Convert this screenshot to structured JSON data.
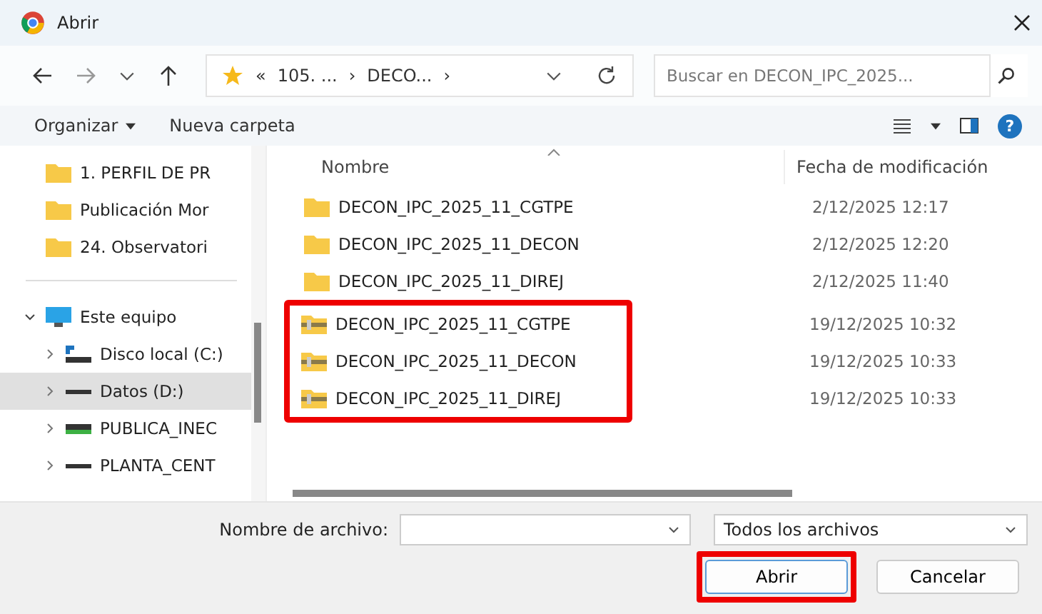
{
  "window": {
    "title": "Abrir"
  },
  "address": {
    "segments": [
      "«",
      "105. ...",
      "›",
      "DECO...",
      "›"
    ]
  },
  "search": {
    "placeholder": "Buscar en DECON_IPC_2025..."
  },
  "toolbar": {
    "organize": "Organizar",
    "new_folder": "Nueva carpeta",
    "help": "?"
  },
  "sidebar": {
    "items": [
      {
        "label": "1. PERFIL DE PR",
        "kind": "folder",
        "selected": false
      },
      {
        "label": "Publicación Mor",
        "kind": "folder",
        "selected": false
      },
      {
        "label": "24. Observatori",
        "kind": "folder",
        "selected": false
      },
      {
        "label": "Este equipo",
        "kind": "pc",
        "selected": false,
        "expanded": true,
        "children": [
          {
            "label": "Disco local (C:)",
            "kind": "system-drive",
            "selected": false,
            "expanded": false
          },
          {
            "label": "Datos (D:)",
            "kind": "drive",
            "selected": true,
            "expanded": false
          },
          {
            "label": "PUBLICA_INEC",
            "kind": "network-drive",
            "selected": false,
            "expanded": false
          },
          {
            "label": "PLANTA_CENT",
            "kind": "drive",
            "selected": false,
            "expanded": false
          }
        ]
      }
    ]
  },
  "table": {
    "columns": [
      "Nombre",
      "Fecha de modificación"
    ],
    "rows": [
      {
        "name": "DECON_IPC_2025_11_CGTPE",
        "date": "2/12/2025 12:17",
        "kind": "folder",
        "highlighted": false
      },
      {
        "name": "DECON_IPC_2025_11_DECON",
        "date": "2/12/2025 12:20",
        "kind": "folder",
        "highlighted": false
      },
      {
        "name": "DECON_IPC_2025_11_DIREJ",
        "date": "2/12/2025 11:40",
        "kind": "folder",
        "highlighted": false
      },
      {
        "name": "DECON_IPC_2025_11_CGTPE",
        "date": "19/12/2025 10:32",
        "kind": "zip",
        "highlighted": true
      },
      {
        "name": "DECON_IPC_2025_11_DECON",
        "date": "19/12/2025 10:33",
        "kind": "zip",
        "highlighted": true
      },
      {
        "name": "DECON_IPC_2025_11_DIREJ",
        "date": "19/12/2025 10:33",
        "kind": "zip",
        "highlighted": true
      }
    ]
  },
  "filename": {
    "label": "Nombre de archivo:"
  },
  "filetype": {
    "value": "Todos los archivos"
  },
  "buttons": [
    {
      "label": "Abrir",
      "highlighted": true
    },
    {
      "label": "Cancelar",
      "highlighted": false
    }
  ]
}
